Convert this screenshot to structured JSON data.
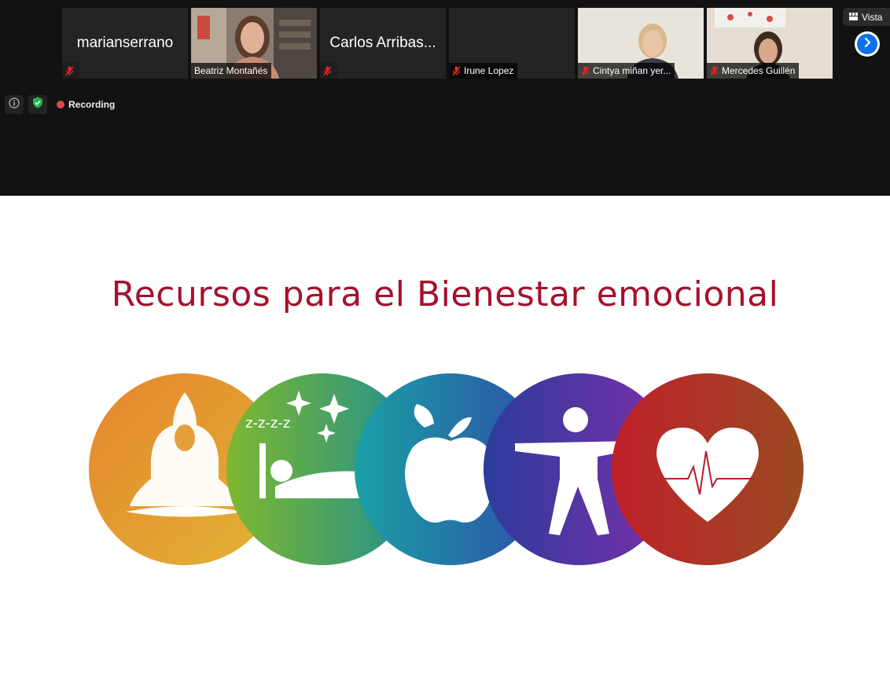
{
  "participants": [
    {
      "id": "p1",
      "name": "marianserrano",
      "show_big_name": true,
      "tag": ""
    },
    {
      "id": "p2",
      "name": "Beatriz Montañés",
      "show_big_name": false,
      "tag": "Beatriz Montañés",
      "active": true
    },
    {
      "id": "p3",
      "name": "Carlos Arribas...",
      "show_big_name": true,
      "tag": ""
    },
    {
      "id": "p4",
      "name": "Irune Lopez",
      "show_big_name": false,
      "tag": "Irune Lopez"
    },
    {
      "id": "p5",
      "name": "Cintya miñan yer...",
      "show_big_name": false,
      "tag": "Cintya miñan yer..."
    },
    {
      "id": "p6",
      "name": "Mercedes Guillén",
      "show_big_name": false,
      "tag": "Mercedes Guillén"
    }
  ],
  "toolbar": {
    "vista_label": "Vista",
    "recording_label": "Recording",
    "next_page_icon": "chevron-right-icon",
    "info_icon": "info-icon",
    "security_icon": "shield-check-icon"
  },
  "slide": {
    "title": "Recursos para el Bienestar emocional",
    "circles": [
      {
        "icon": "meditation-icon"
      },
      {
        "icon": "sleep-icon"
      },
      {
        "icon": "apple-icon"
      },
      {
        "icon": "person-icon"
      },
      {
        "icon": "heart-pulse-icon"
      }
    ]
  },
  "colors": {
    "title": "#a5112e",
    "active_border": "#d9d983",
    "recording_dot": "#e8424a",
    "next_button": "#0e71eb"
  }
}
